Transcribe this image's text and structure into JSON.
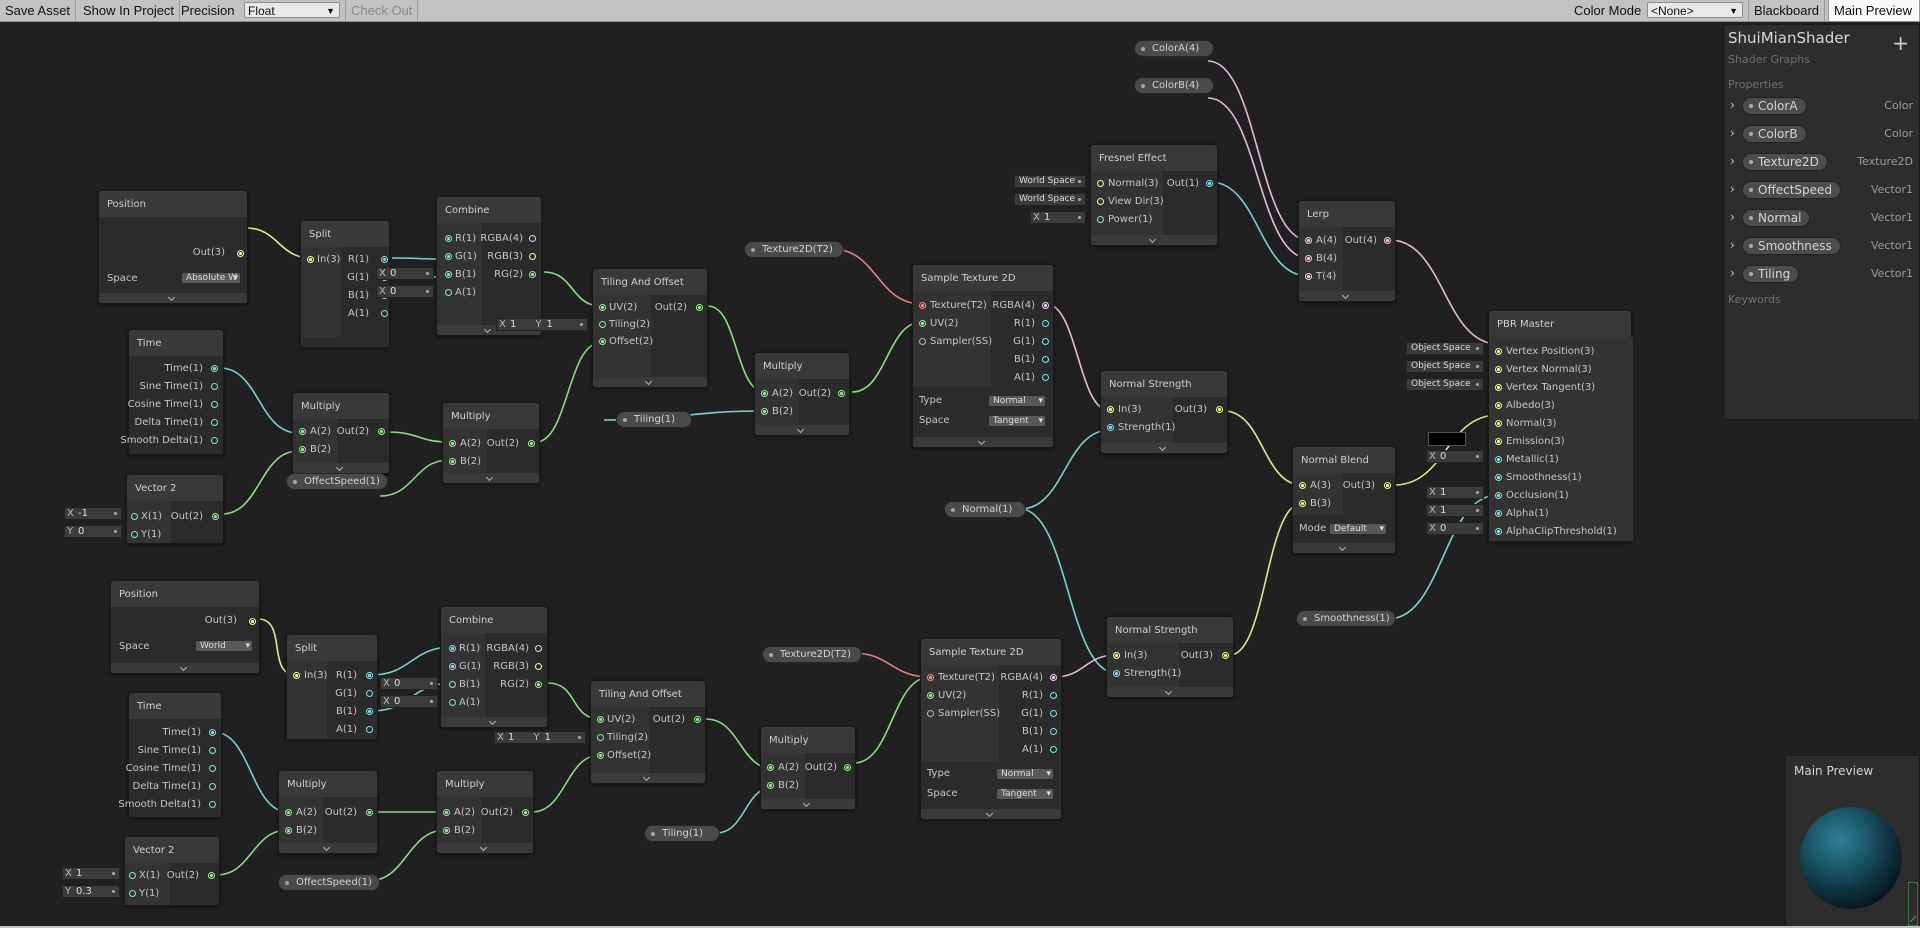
{
  "toolbar": {
    "save_asset": "Save Asset",
    "show_in_project": "Show In Project",
    "precision_label": "Precision",
    "precision_value": "Float",
    "check_out": "Check Out",
    "color_mode_label": "Color Mode",
    "color_mode_value": "<None>",
    "blackboard": "Blackboard",
    "main_preview": "Main Preview"
  },
  "blackboard": {
    "title": "ShuiMianShader",
    "subtitle": "Shader Graphs",
    "add": "+",
    "properties_header": "Properties",
    "keywords_header": "Keywords",
    "properties": [
      {
        "name": "ColorA",
        "type": "Color"
      },
      {
        "name": "ColorB",
        "type": "Color"
      },
      {
        "name": "Texture2D",
        "type": "Texture2D"
      },
      {
        "name": "OffectSpeed",
        "type": "Vector1"
      },
      {
        "name": "Normal",
        "type": "Vector1"
      },
      {
        "name": "Smoothness",
        "type": "Vector1"
      },
      {
        "name": "Tiling",
        "type": "Vector1"
      }
    ]
  },
  "preview": {
    "title": "Main Preview"
  },
  "colors": {
    "vector1": "#84e4e7",
    "vector2": "#9aef92",
    "vector3": "#f6ff9a",
    "vector4": "#fbcbf4",
    "texture": "#ff8b8b",
    "sampler": "#b7b7b7"
  },
  "nodes": {
    "position1": {
      "title": "Position",
      "out": "Out(3)",
      "space_label": "Space",
      "space_value": "Absolute W"
    },
    "split1": {
      "title": "Split",
      "in": "In(3)",
      "outs": [
        "R(1)",
        "G(1)",
        "B(1)",
        "A(1)"
      ]
    },
    "combine1": {
      "title": "Combine",
      "ins": [
        "R(1)",
        "G(1)",
        "B(1)",
        "A(1)"
      ],
      "outs": [
        "RGBA(4)",
        "RGB(3)",
        "RG(2)"
      ],
      "x": "X",
      "v1": "0",
      "v2": "0"
    },
    "tiling1": {
      "title": "Tiling And Offset",
      "ins": [
        "UV(2)",
        "Tiling(2)",
        "Offset(2)"
      ],
      "out": "Out(2)",
      "x": "X",
      "xv": "1",
      "y": "Y",
      "yv": "1"
    },
    "multiply1": {
      "title": "Multiply",
      "ins": [
        "A(2)",
        "B(2)"
      ],
      "out": "Out(2)"
    },
    "sample1": {
      "title": "Sample Texture 2D",
      "ins": [
        "Texture(T2)",
        "UV(2)",
        "Sampler(SS)"
      ],
      "outs": [
        "RGBA(4)",
        "R(1)",
        "G(1)",
        "B(1)",
        "A(1)"
      ],
      "type_label": "Type",
      "type_value": "Normal",
      "space_label": "Space",
      "space_value": "Tangent"
    },
    "time1": {
      "title": "Time",
      "outs": [
        "Time(1)",
        "Sine Time(1)",
        "Cosine Time(1)",
        "Delta Time(1)",
        "Smooth Delta(1)"
      ]
    },
    "multiply2": {
      "title": "Multiply",
      "ins": [
        "A(2)",
        "B(2)"
      ],
      "out": "Out(2)"
    },
    "multiply3": {
      "title": "Multiply",
      "ins": [
        "A(2)",
        "B(2)"
      ],
      "out": "Out(2)"
    },
    "vector2a": {
      "title": "Vector 2",
      "ins": [
        "X(1)",
        "Y(1)"
      ],
      "out": "Out(2)",
      "x": "X",
      "xv": "-1",
      "y": "Y",
      "yv": "0"
    },
    "fresnel": {
      "title": "Fresnel Effect",
      "ins": [
        "Normal(3)",
        "View Dir(3)",
        "Power(1)"
      ],
      "out": "Out(1)",
      "ws1": "World Space",
      "ws2": "World Space",
      "x": "X",
      "xv": "1"
    },
    "lerp": {
      "title": "Lerp",
      "ins": [
        "A(4)",
        "B(4)",
        "T(4)"
      ],
      "out": "Out(4)"
    },
    "normalstr1": {
      "title": "Normal Strength",
      "ins": [
        "In(3)",
        "Strength(1)"
      ],
      "out": "Out(3)"
    },
    "normalblend": {
      "title": "Normal Blend",
      "ins": [
        "A(3)",
        "B(3)"
      ],
      "out": "Out(3)",
      "mode_label": "Mode",
      "mode_value": "Default"
    },
    "normalstr2": {
      "title": "Normal Strength",
      "ins": [
        "In(3)",
        "Strength(1)"
      ],
      "out": "Out(3)"
    },
    "pbr": {
      "title": "PBR Master",
      "ins": [
        "Vertex Position(3)",
        "Vertex Normal(3)",
        "Vertex Tangent(3)",
        "Albedo(3)",
        "Normal(3)",
        "Emission(3)",
        "Metallic(1)",
        "Smoothness(1)",
        "Occlusion(1)",
        "Alpha(1)",
        "AlphaClipThreshold(1)"
      ],
      "os1": "Object Space",
      "os2": "Object Space",
      "os3": "Object Space",
      "x": "X",
      "metallic": "0",
      "occlusion": "1",
      "alpha": "1",
      "clip": "0"
    },
    "position2": {
      "title": "Position",
      "out": "Out(3)",
      "space_label": "Space",
      "space_value": "World"
    },
    "split2": {
      "title": "Split",
      "in": "In(3)",
      "outs": [
        "R(1)",
        "G(1)",
        "B(1)",
        "A(1)"
      ]
    },
    "combine2": {
      "title": "Combine",
      "ins": [
        "R(1)",
        "G(1)",
        "B(1)",
        "A(1)"
      ],
      "outs": [
        "RGBA(4)",
        "RGB(3)",
        "RG(2)"
      ],
      "x": "X",
      "v1": "0",
      "v2": "0"
    },
    "tiling2": {
      "title": "Tiling And Offset",
      "ins": [
        "UV(2)",
        "Tiling(2)",
        "Offset(2)"
      ],
      "out": "Out(2)",
      "x": "X",
      "xv": "1",
      "y": "Y",
      "yv": "1"
    },
    "multiply4": {
      "title": "Multiply",
      "ins": [
        "A(2)",
        "B(2)"
      ],
      "out": "Out(2)"
    },
    "sample2": {
      "title": "Sample Texture 2D",
      "ins": [
        "Texture(T2)",
        "UV(2)",
        "Sampler(SS)"
      ],
      "outs": [
        "RGBA(4)",
        "R(1)",
        "G(1)",
        "B(1)",
        "A(1)"
      ],
      "type_label": "Type",
      "type_value": "Normal",
      "space_label": "Space",
      "space_value": "Tangent"
    },
    "time2": {
      "title": "Time",
      "outs": [
        "Time(1)",
        "Sine Time(1)",
        "Cosine Time(1)",
        "Delta Time(1)",
        "Smooth Delta(1)"
      ]
    },
    "multiply5": {
      "title": "Multiply",
      "ins": [
        "A(2)",
        "B(2)"
      ],
      "out": "Out(2)"
    },
    "multiply6": {
      "title": "Multiply",
      "ins": [
        "A(2)",
        "B(2)"
      ],
      "out": "Out(2)"
    },
    "vector2b": {
      "title": "Vector 2",
      "ins": [
        "X(1)",
        "Y(1)"
      ],
      "out": "Out(2)",
      "x": "X",
      "xv": "1",
      "y": "Y",
      "yv": "0.3"
    }
  },
  "pills": {
    "colorA": "ColorA(4)",
    "colorB": "ColorB(4)",
    "tex1": "Texture2D(T2)",
    "tiling1": "Tiling(1)",
    "offect1": "OffectSpeed(1)",
    "normal": "Normal(1)",
    "smooth": "Smoothness(1)",
    "tex2": "Texture2D(T2)",
    "tiling2": "Tiling(1)",
    "offect2": "OffectSpeed(1)"
  }
}
